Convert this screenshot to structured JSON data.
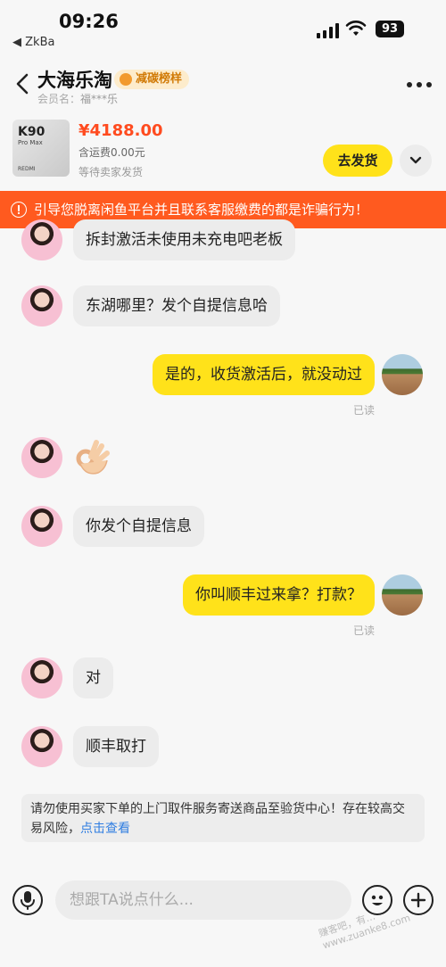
{
  "status_bar": {
    "time": "09:26",
    "back_app": "◀ ZkBa",
    "battery": "93"
  },
  "header": {
    "shop_name": "大海乐淘",
    "badge": "减碳榜样",
    "member_label": "会员名：",
    "member_value": "福***乐"
  },
  "product": {
    "thumb_title": "K90",
    "thumb_sub": "Pro Max",
    "thumb_brand": "REDMI",
    "price": "¥4188.00",
    "shipping": "含运费0.00元",
    "status": "等待卖家发货",
    "ship_button": "去发货"
  },
  "warning": "引导您脱离闲鱼平台并且联系客服缴费的都是诈骗行为！",
  "messages": [
    {
      "from": "seller",
      "text": "拆封激活未使用未充电吧老板"
    },
    {
      "from": "seller",
      "text": "东湖哪里？发个自提信息哈"
    },
    {
      "from": "buyer",
      "text": "是的，收货激活后，就没动过",
      "status": "已读"
    },
    {
      "from": "seller",
      "emoji": "ok-hand-emoji"
    },
    {
      "from": "seller",
      "text": "你发个自提信息"
    },
    {
      "from": "buyer",
      "text": "你叫顺丰过来拿？打款？",
      "status": "已读"
    },
    {
      "from": "seller",
      "text": "对"
    },
    {
      "from": "seller",
      "text": "顺丰取打"
    }
  ],
  "notice": {
    "text": "请勿使用买家下单的上门取件服务寄送商品至验货中心！存在较高交易风险，",
    "link": "点击查看"
  },
  "input": {
    "placeholder": "想跟TA说点什么..."
  },
  "watermark": "赚客吧，有… www.zuanke8.com",
  "colors": {
    "accent_yellow": "#ffe21a",
    "warning_orange": "#ff5a1f",
    "price_red": "#ff4b1f",
    "link_blue": "#2f7de1"
  }
}
